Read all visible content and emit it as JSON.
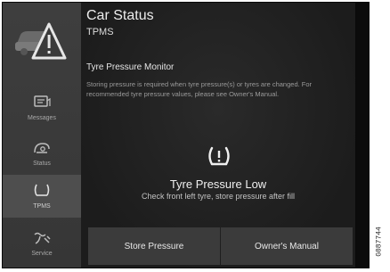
{
  "header": {
    "title": "Car Status",
    "subtitle": "TPMS"
  },
  "sidebar": {
    "items": [
      {
        "label": "Messages",
        "icon": "messages-icon"
      },
      {
        "label": "Status",
        "icon": "status-icon"
      },
      {
        "label": "TPMS",
        "icon": "tpms-icon",
        "active": true
      },
      {
        "label": "Service",
        "icon": "service-icon"
      }
    ]
  },
  "main": {
    "section_heading": "Tyre Pressure Monitor",
    "description": "Storing pressure is required when tyre pressure(s) or tyres are changed. For recommended tyre pressure values, please see Owner's Manual.",
    "alert_title": "Tyre Pressure Low",
    "alert_detail": "Check front left tyre, store pressure after fill"
  },
  "buttons": {
    "store_pressure": "Store Pressure",
    "owners_manual": "Owner's Manual"
  },
  "figure_code": "G087744",
  "colors": {
    "background": "#1e1e1e",
    "sidebar": "#3a3a3a",
    "active_item": "#4e4e4e",
    "button": "#3b3b3b",
    "text": "#e8e8e8"
  }
}
